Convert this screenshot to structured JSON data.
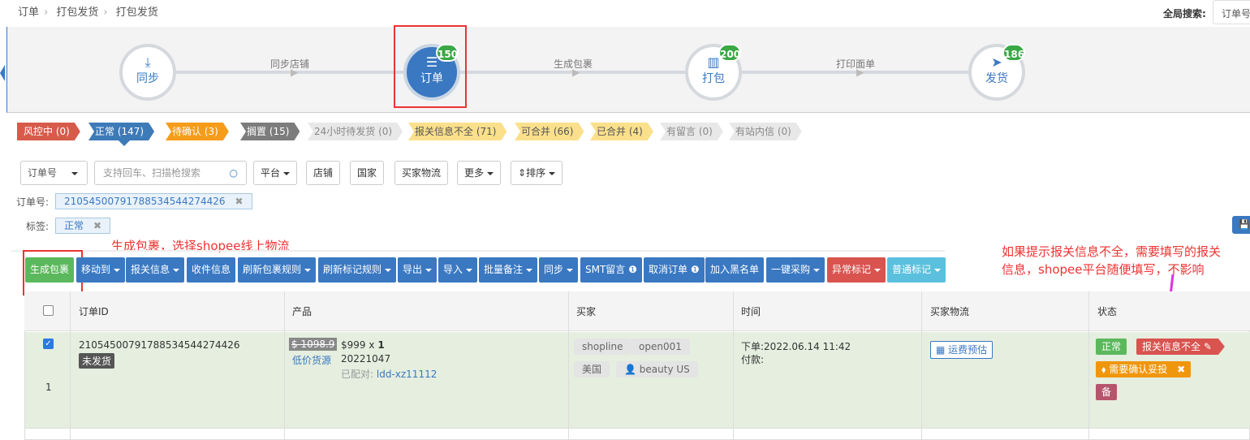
{
  "breadcrumb": [
    "订单",
    "打包发货",
    "打包发货"
  ],
  "global_search": {
    "label": "全局搜索:",
    "selected": "订单号"
  },
  "flow": {
    "steps": [
      {
        "label": "同步",
        "badge": ""
      },
      {
        "label": "订单",
        "badge": "150"
      },
      {
        "label": "打包",
        "badge": "200"
      },
      {
        "label": "发货",
        "badge": "186"
      }
    ],
    "connectors": [
      "同步店铺",
      "生成包裹",
      "打印面单"
    ]
  },
  "status_tags": [
    "风控中 (0)",
    "正常 (147)",
    "待确认 (3)",
    "搁置 (15)",
    "24小时待发货 (0)",
    "报关信息不全 (71)",
    "可合并 (66)",
    "已合并 (4)",
    "有留言 (0)",
    "有站内信 (0)"
  ],
  "filters": {
    "search_type": "订单号",
    "search_placeholder": "支持回车、扫描枪搜索",
    "platform": "平台",
    "shop": "店铺",
    "country": "国家",
    "buyer_logistics": "买家物流",
    "more": "更多",
    "sort": "排序"
  },
  "active_filters": {
    "order_label": "订单号:",
    "order_value": "2105450079178853454427442​6",
    "tag_label": "标签:",
    "tag_value": "正常"
  },
  "annotations": {
    "top": "生成包裹，选择shopee线上物流",
    "right_line1": "如果提示报关信息不全，需要填写的报关",
    "right_line2": "信息，shopee平台随便填写，不影响"
  },
  "actions": [
    "生成包裹",
    "移动到",
    "报关信息",
    "收件信息",
    "刷新包裹规则",
    "刷新标记规则",
    "导出",
    "导入",
    "批量备注",
    "同步",
    "SMT留言",
    "取消订单",
    "加入黑名单",
    "一键采购",
    "异常标记",
    "普通标记"
  ],
  "table": {
    "headers": [
      "订单ID",
      "产品",
      "买家",
      "时间",
      "买家物流",
      "状态"
    ],
    "row": {
      "index": "1",
      "order_id": "210545007917885345442744​26",
      "ship_status": "未发货",
      "orig_price": "$ 1098.9",
      "source": "低价货源",
      "price": "$999",
      "qty_sep": "x",
      "qty": "1",
      "sku": "20221047",
      "matched_label": "已配对:",
      "matched_value": "ldd-xz11112",
      "buyer_shop": "shopline",
      "buyer_store": "open001",
      "buyer_country": "美国",
      "buyer_name": "beauty US",
      "order_time": "下单:2022.06.14 11:42",
      "pay_time": "付款:",
      "freight_button": "运费预估",
      "status_normal": "正常",
      "status_customs": "报关信息不全",
      "status_confirm": "需要确认妥投",
      "status_note": "备"
    }
  },
  "colors": {
    "primary": "#3a78c2",
    "green": "#5cb85c",
    "danger": "#d9534f",
    "annotation": "#e33333"
  }
}
